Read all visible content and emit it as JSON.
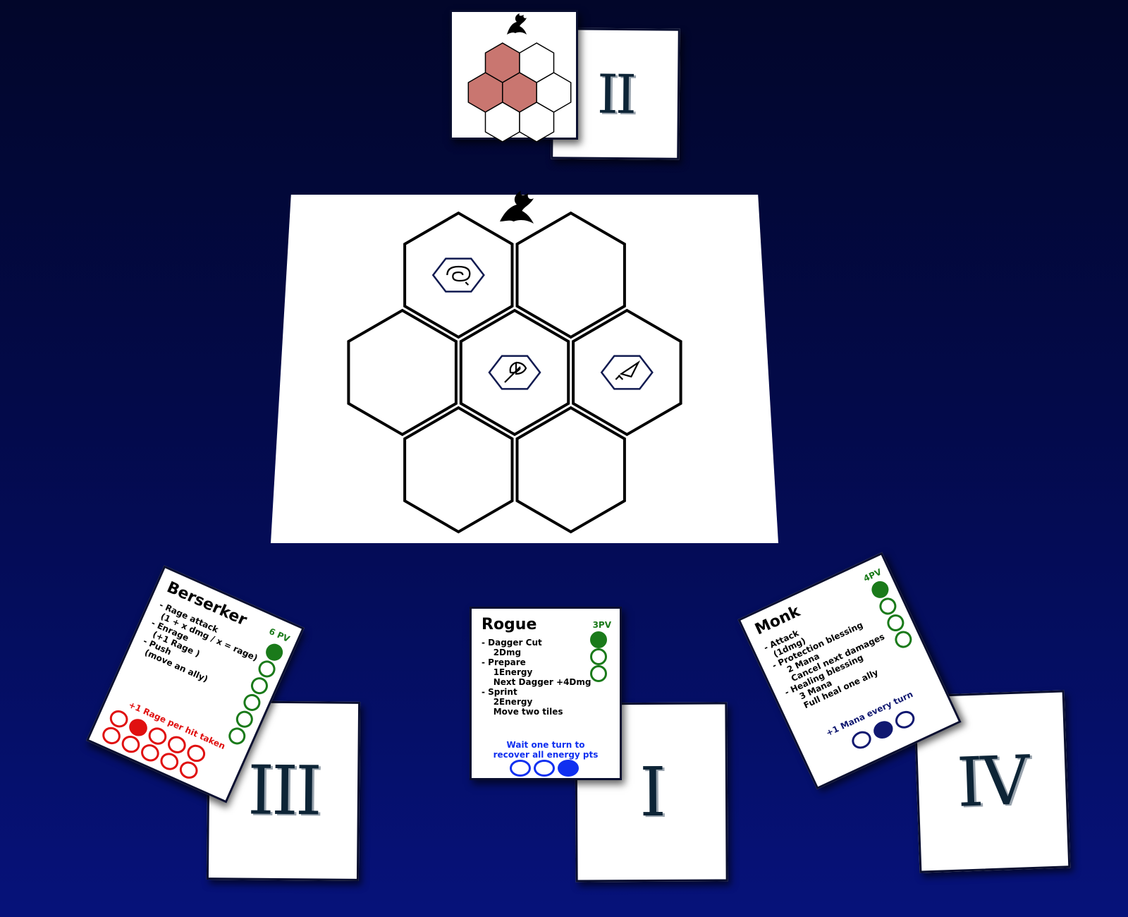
{
  "colors": {
    "background_top": "#02062a",
    "background_bottom": "#06127a",
    "hex_highlight": "#c97670",
    "pv_green": "#1a7a1a",
    "rage_red": "#e01010",
    "energy_blue": "#1030f0",
    "mana_navy": "#101870"
  },
  "top": {
    "enemy_icon": "dragon-silhouette-icon",
    "pattern_highlighted": [
      true,
      false,
      true,
      true,
      false,
      false,
      false
    ],
    "numeral": "II"
  },
  "board": {
    "enemy_icon": "dragon-silhouette-icon",
    "tiles": [
      {
        "token": "chain-whip-icon"
      },
      {
        "token": null
      },
      {
        "token": null
      },
      {
        "token": "axe-icon"
      },
      {
        "token": "dagger-icon"
      },
      {
        "token": null
      },
      {
        "token": null
      }
    ]
  },
  "players": [
    {
      "numeral": "III",
      "name": "Berserker",
      "pv_label": "6 PV",
      "pv_max": 6,
      "pv_filled": 1,
      "abilities": "- Rage attack\n  (1 + x dmg / x = rage)\n- Enrage\n  (+1 Rage )\n- Push\n  (move an ally)",
      "resource_label": "+1 Rage per hit taken",
      "resource_max": 10,
      "resource_filled": 1
    },
    {
      "numeral": "I",
      "name": "Rogue",
      "pv_label": "3PV",
      "pv_max": 3,
      "pv_filled": 1,
      "abilities": "- Dagger Cut\n    2Dmg\n- Prepare\n    1Energy\n    Next Dagger +4Dmg\n- Sprint\n    2Energy\n    Move two tiles",
      "resource_label": "Wait one turn to recover all energy pts",
      "resource_max": 3,
      "resource_filled": 1
    },
    {
      "numeral": "IV",
      "name": "Monk",
      "pv_label": "4PV",
      "pv_max": 4,
      "pv_filled": 1,
      "abilities": "- Attack\n  (1dmg)\n- Protection blessing\n    2 Mana\n    Cancel next damages\n- Healing blessing\n    3 Mana\n    Full heal one ally",
      "resource_label": "+1 Mana every turn",
      "resource_max": 3,
      "resource_filled": 1
    }
  ]
}
